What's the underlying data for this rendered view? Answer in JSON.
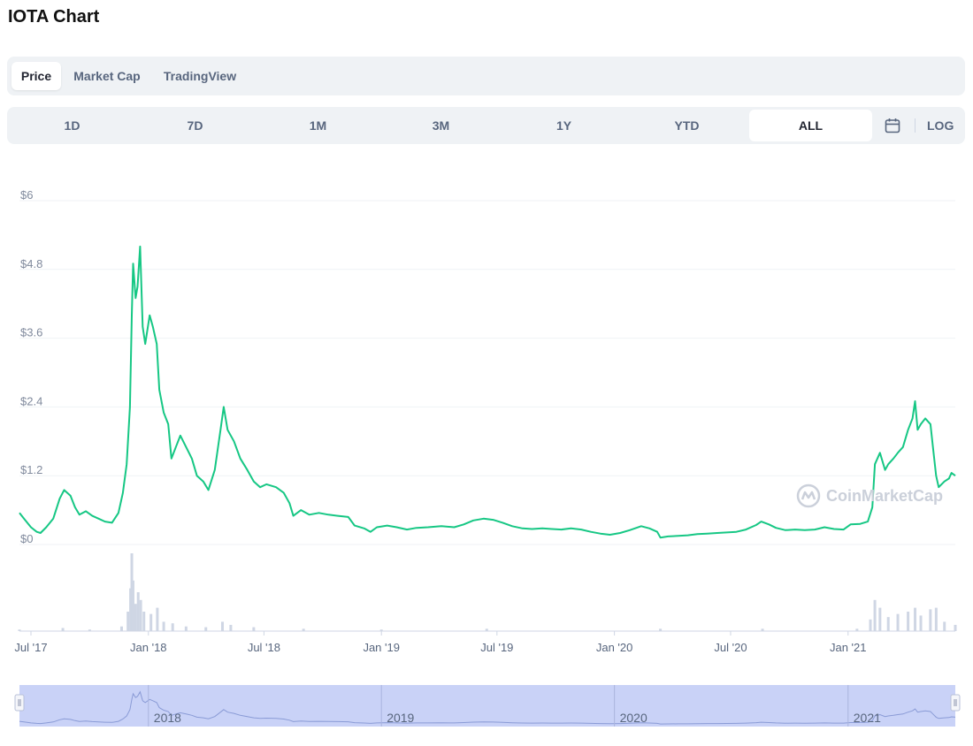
{
  "page": {
    "title": "IOTA Chart"
  },
  "tabs": [
    {
      "label": "Price",
      "active": true
    },
    {
      "label": "Market Cap",
      "active": false
    },
    {
      "label": "TradingView",
      "active": false
    }
  ],
  "ranges": [
    {
      "label": "1D",
      "active": false
    },
    {
      "label": "7D",
      "active": false
    },
    {
      "label": "1M",
      "active": false
    },
    {
      "label": "3M",
      "active": false
    },
    {
      "label": "1Y",
      "active": false
    },
    {
      "label": "YTD",
      "active": false
    },
    {
      "label": "ALL",
      "active": true
    }
  ],
  "toolbar": {
    "calendar_icon": "calendar-icon",
    "log_label": "LOG"
  },
  "watermark": {
    "text": "CoinMarketCap",
    "icon": "coinmarketcap-logo-icon"
  },
  "colors": {
    "line": "#16c784",
    "volume": "#cfd6e4",
    "grid": "#eff2f5",
    "navigator_fill": "#c9d2f7",
    "navigator_line": "#8a9bd6"
  },
  "chart_data": {
    "type": "line",
    "x_unit": "date",
    "y_ticks": [
      "$0",
      "$1.2",
      "$2.4",
      "$3.6",
      "$4.8",
      "$6"
    ],
    "y_tick_values": [
      0,
      1.2,
      2.4,
      3.6,
      4.8,
      6
    ],
    "ylim": [
      0,
      6
    ],
    "x_ticks": [
      {
        "label": "Jul '17",
        "date": "2017-07-01"
      },
      {
        "label": "Jan '18",
        "date": "2018-01-01"
      },
      {
        "label": "Jul '18",
        "date": "2018-07-01"
      },
      {
        "label": "Jan '19",
        "date": "2019-01-01"
      },
      {
        "label": "Jul '19",
        "date": "2019-07-01"
      },
      {
        "label": "Jan '20",
        "date": "2020-01-01"
      },
      {
        "label": "Jul '20",
        "date": "2020-07-01"
      },
      {
        "label": "Jan '21",
        "date": "2021-01-01"
      }
    ],
    "x_range": [
      "2017-06-13",
      "2021-06-18"
    ],
    "grid": true,
    "series": [
      {
        "points": [
          [
            "2017-06-13",
            0.55
          ],
          [
            "2017-06-20",
            0.45
          ],
          [
            "2017-07-01",
            0.3
          ],
          [
            "2017-07-10",
            0.22
          ],
          [
            "2017-07-16",
            0.2
          ],
          [
            "2017-07-25",
            0.3
          ],
          [
            "2017-08-05",
            0.45
          ],
          [
            "2017-08-15",
            0.8
          ],
          [
            "2017-08-22",
            0.95
          ],
          [
            "2017-09-01",
            0.85
          ],
          [
            "2017-09-08",
            0.65
          ],
          [
            "2017-09-15",
            0.52
          ],
          [
            "2017-09-25",
            0.58
          ],
          [
            "2017-10-05",
            0.5
          ],
          [
            "2017-10-15",
            0.45
          ],
          [
            "2017-10-25",
            0.4
          ],
          [
            "2017-11-05",
            0.38
          ],
          [
            "2017-11-15",
            0.55
          ],
          [
            "2017-11-22",
            0.9
          ],
          [
            "2017-11-28",
            1.4
          ],
          [
            "2017-12-03",
            2.4
          ],
          [
            "2017-12-06",
            4.0
          ],
          [
            "2017-12-08",
            4.9
          ],
          [
            "2017-12-12",
            4.3
          ],
          [
            "2017-12-15",
            4.5
          ],
          [
            "2017-12-19",
            5.2
          ],
          [
            "2017-12-23",
            3.8
          ],
          [
            "2017-12-27",
            3.5
          ],
          [
            "2018-01-03",
            4.0
          ],
          [
            "2018-01-08",
            3.8
          ],
          [
            "2018-01-14",
            3.5
          ],
          [
            "2018-01-18",
            2.7
          ],
          [
            "2018-01-25",
            2.3
          ],
          [
            "2018-02-01",
            2.1
          ],
          [
            "2018-02-06",
            1.5
          ],
          [
            "2018-02-13",
            1.7
          ],
          [
            "2018-02-20",
            1.9
          ],
          [
            "2018-03-01",
            1.7
          ],
          [
            "2018-03-10",
            1.5
          ],
          [
            "2018-03-18",
            1.2
          ],
          [
            "2018-03-28",
            1.1
          ],
          [
            "2018-04-05",
            0.95
          ],
          [
            "2018-04-15",
            1.3
          ],
          [
            "2018-04-24",
            2.0
          ],
          [
            "2018-04-29",
            2.4
          ],
          [
            "2018-05-05",
            2.0
          ],
          [
            "2018-05-15",
            1.8
          ],
          [
            "2018-05-25",
            1.5
          ],
          [
            "2018-06-05",
            1.3
          ],
          [
            "2018-06-15",
            1.1
          ],
          [
            "2018-06-25",
            1.0
          ],
          [
            "2018-07-05",
            1.05
          ],
          [
            "2018-07-20",
            1.0
          ],
          [
            "2018-08-01",
            0.9
          ],
          [
            "2018-08-10",
            0.72
          ],
          [
            "2018-08-16",
            0.5
          ],
          [
            "2018-08-28",
            0.6
          ],
          [
            "2018-09-10",
            0.52
          ],
          [
            "2018-09-25",
            0.55
          ],
          [
            "2018-10-10",
            0.52
          ],
          [
            "2018-10-25",
            0.5
          ],
          [
            "2018-11-10",
            0.48
          ],
          [
            "2018-11-20",
            0.33
          ],
          [
            "2018-12-05",
            0.28
          ],
          [
            "2018-12-15",
            0.22
          ],
          [
            "2018-12-25",
            0.3
          ],
          [
            "2019-01-10",
            0.33
          ],
          [
            "2019-01-25",
            0.3
          ],
          [
            "2019-02-10",
            0.26
          ],
          [
            "2019-02-25",
            0.29
          ],
          [
            "2019-03-15",
            0.3
          ],
          [
            "2019-04-05",
            0.32
          ],
          [
            "2019-04-25",
            0.3
          ],
          [
            "2019-05-10",
            0.35
          ],
          [
            "2019-05-25",
            0.42
          ],
          [
            "2019-06-10",
            0.45
          ],
          [
            "2019-06-25",
            0.43
          ],
          [
            "2019-07-10",
            0.38
          ],
          [
            "2019-07-25",
            0.32
          ],
          [
            "2019-08-10",
            0.28
          ],
          [
            "2019-08-25",
            0.27
          ],
          [
            "2019-09-10",
            0.28
          ],
          [
            "2019-09-25",
            0.27
          ],
          [
            "2019-10-10",
            0.26
          ],
          [
            "2019-10-25",
            0.28
          ],
          [
            "2019-11-10",
            0.26
          ],
          [
            "2019-11-25",
            0.22
          ],
          [
            "2019-12-10",
            0.19
          ],
          [
            "2019-12-25",
            0.17
          ],
          [
            "2020-01-10",
            0.2
          ],
          [
            "2020-01-25",
            0.25
          ],
          [
            "2020-02-12",
            0.32
          ],
          [
            "2020-02-25",
            0.28
          ],
          [
            "2020-03-08",
            0.22
          ],
          [
            "2020-03-13",
            0.12
          ],
          [
            "2020-03-25",
            0.14
          ],
          [
            "2020-04-10",
            0.15
          ],
          [
            "2020-04-25",
            0.16
          ],
          [
            "2020-05-10",
            0.18
          ],
          [
            "2020-05-25",
            0.19
          ],
          [
            "2020-06-10",
            0.2
          ],
          [
            "2020-06-25",
            0.21
          ],
          [
            "2020-07-10",
            0.22
          ],
          [
            "2020-07-25",
            0.26
          ],
          [
            "2020-08-10",
            0.34
          ],
          [
            "2020-08-18",
            0.4
          ],
          [
            "2020-08-30",
            0.35
          ],
          [
            "2020-09-10",
            0.29
          ],
          [
            "2020-09-25",
            0.25
          ],
          [
            "2020-10-10",
            0.26
          ],
          [
            "2020-10-25",
            0.25
          ],
          [
            "2020-11-10",
            0.26
          ],
          [
            "2020-11-25",
            0.3
          ],
          [
            "2020-12-10",
            0.27
          ],
          [
            "2020-12-25",
            0.26
          ],
          [
            "2021-01-05",
            0.35
          ],
          [
            "2021-01-20",
            0.36
          ],
          [
            "2021-02-01",
            0.4
          ],
          [
            "2021-02-08",
            0.65
          ],
          [
            "2021-02-12",
            1.4
          ],
          [
            "2021-02-20",
            1.6
          ],
          [
            "2021-02-28",
            1.3
          ],
          [
            "2021-03-05",
            1.4
          ],
          [
            "2021-03-13",
            1.5
          ],
          [
            "2021-03-20",
            1.6
          ],
          [
            "2021-03-28",
            1.7
          ],
          [
            "2021-04-05",
            2.0
          ],
          [
            "2021-04-12",
            2.2
          ],
          [
            "2021-04-16",
            2.5
          ],
          [
            "2021-04-20",
            2.0
          ],
          [
            "2021-04-25",
            2.1
          ],
          [
            "2021-05-02",
            2.2
          ],
          [
            "2021-05-10",
            2.1
          ],
          [
            "2021-05-14",
            1.7
          ],
          [
            "2021-05-19",
            1.2
          ],
          [
            "2021-05-23",
            1.0
          ],
          [
            "2021-06-01",
            1.1
          ],
          [
            "2021-06-08",
            1.15
          ],
          [
            "2021-06-12",
            1.25
          ],
          [
            "2021-06-18",
            1.2
          ]
        ]
      }
    ],
    "volume": {
      "ylim": [
        0,
        1
      ],
      "points": [
        [
          "2017-06-13",
          0.02
        ],
        [
          "2017-08-20",
          0.04
        ],
        [
          "2017-10-01",
          0.02
        ],
        [
          "2017-11-20",
          0.06
        ],
        [
          "2017-11-30",
          0.25
        ],
        [
          "2017-12-04",
          0.55
        ],
        [
          "2017-12-06",
          1.0
        ],
        [
          "2017-12-08",
          0.65
        ],
        [
          "2017-12-12",
          0.35
        ],
        [
          "2017-12-16",
          0.5
        ],
        [
          "2017-12-20",
          0.4
        ],
        [
          "2017-12-25",
          0.25
        ],
        [
          "2018-01-05",
          0.22
        ],
        [
          "2018-01-15",
          0.3
        ],
        [
          "2018-01-25",
          0.12
        ],
        [
          "2018-02-08",
          0.1
        ],
        [
          "2018-03-01",
          0.06
        ],
        [
          "2018-04-01",
          0.05
        ],
        [
          "2018-04-27",
          0.12
        ],
        [
          "2018-05-10",
          0.08
        ],
        [
          "2018-06-15",
          0.05
        ],
        [
          "2018-09-01",
          0.03
        ],
        [
          "2019-01-01",
          0.02
        ],
        [
          "2019-06-15",
          0.03
        ],
        [
          "2020-03-13",
          0.03
        ],
        [
          "2020-08-20",
          0.03
        ],
        [
          "2021-01-15",
          0.03
        ],
        [
          "2021-02-05",
          0.15
        ],
        [
          "2021-02-12",
          0.4
        ],
        [
          "2021-02-20",
          0.3
        ],
        [
          "2021-03-05",
          0.18
        ],
        [
          "2021-03-20",
          0.22
        ],
        [
          "2021-04-05",
          0.25
        ],
        [
          "2021-04-16",
          0.3
        ],
        [
          "2021-04-25",
          0.2
        ],
        [
          "2021-05-10",
          0.28
        ],
        [
          "2021-05-19",
          0.3
        ],
        [
          "2021-06-01",
          0.12
        ],
        [
          "2021-06-18",
          0.08
        ]
      ]
    },
    "navigator": {
      "labels": [
        {
          "label": "2018",
          "date": "2018-01-01"
        },
        {
          "label": "2019",
          "date": "2019-01-01"
        },
        {
          "label": "2020",
          "date": "2020-01-01"
        },
        {
          "label": "2021",
          "date": "2021-01-01"
        }
      ]
    }
  }
}
